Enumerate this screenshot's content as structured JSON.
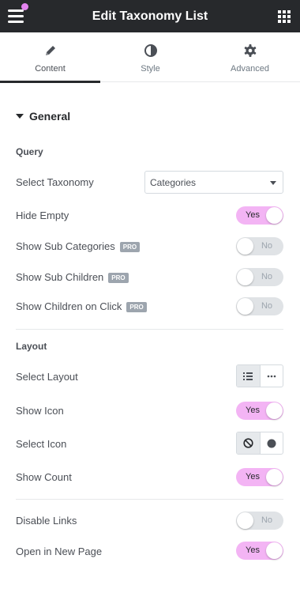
{
  "header": {
    "title": "Edit Taxonomy List"
  },
  "tabs": [
    {
      "label": "Content",
      "icon": "pencil-icon",
      "active": true
    },
    {
      "label": "Style",
      "icon": "half-circle-icon",
      "active": false
    },
    {
      "label": "Advanced",
      "icon": "gear-icon",
      "active": false
    }
  ],
  "section": {
    "title": "General"
  },
  "query": {
    "heading": "Query",
    "select_taxonomy": {
      "label": "Select Taxonomy",
      "value": "Categories"
    },
    "hide_empty": {
      "label": "Hide Empty",
      "state": "Yes"
    },
    "show_sub_categories": {
      "label": "Show Sub Categories",
      "badge": "PRO",
      "state": "No"
    },
    "show_sub_children": {
      "label": "Show Sub Children",
      "badge": "PRO",
      "state": "No"
    },
    "show_children_on_click": {
      "label": "Show Children on Click",
      "badge": "PRO",
      "state": "No"
    }
  },
  "layout": {
    "heading": "Layout",
    "select_layout": {
      "label": "Select Layout",
      "selected": "list"
    },
    "show_icon": {
      "label": "Show Icon",
      "state": "Yes"
    },
    "select_icon": {
      "label": "Select Icon",
      "selected": "none"
    },
    "show_count": {
      "label": "Show Count",
      "state": "Yes"
    }
  },
  "links": {
    "disable_links": {
      "label": "Disable Links",
      "state": "No"
    },
    "open_in_new_page": {
      "label": "Open in New Page",
      "state": "Yes"
    }
  },
  "colors": {
    "toggle_on": "#f3b4f4",
    "toggle_off": "#e0e3e6",
    "topbar": "#27292c",
    "notification_dot": "#e484f0"
  }
}
